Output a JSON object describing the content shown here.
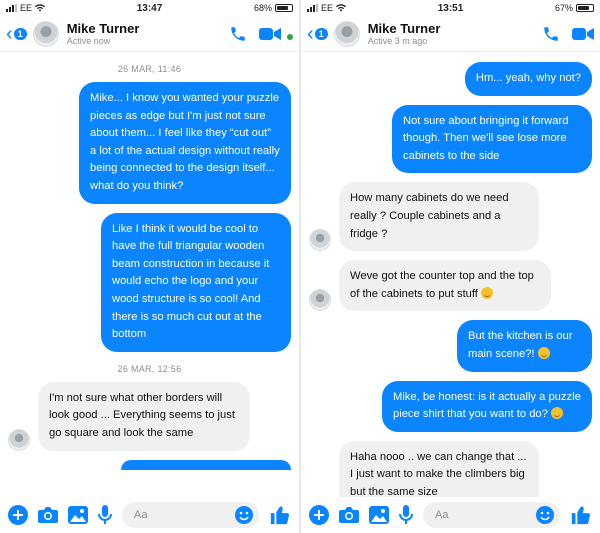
{
  "colors": {
    "accent": "#0a84ff",
    "incoming": "#f0f0f0",
    "online": "#31a24c"
  },
  "left": {
    "status": {
      "carrier": "EE",
      "time": "13:47",
      "battery": "68%"
    },
    "header": {
      "back_count": "1",
      "name": "Mike Turner",
      "sub": "Active now"
    },
    "messages": [
      {
        "type": "stamp",
        "text": "26 MAR, 11:46"
      },
      {
        "type": "out",
        "text": "Mike... I know you wanted your puzzle pieces as edge but I'm just not sure about them... I feel like they “cut out” a lot of the actual design without really being connected to the design itself... what do you think?"
      },
      {
        "type": "out",
        "text": "Like I think it would be cool to have the full triangular wooden beam construction in because it would echo the logo and your wood structure is so cool! And there is so much cut out at the bottom"
      },
      {
        "type": "stamp",
        "text": "26 MAR, 12:56"
      },
      {
        "type": "in",
        "text": "I'm not sure what other borders will look good ... Everything seems to just go square and look the same"
      }
    ],
    "composer": {
      "placeholder": "Aa"
    }
  },
  "right": {
    "status": {
      "carrier": "EE",
      "time": "13:51",
      "battery": "67%"
    },
    "header": {
      "back_count": "1",
      "name": "Mike Turner",
      "sub": "Active 3 m ago"
    },
    "messages": [
      {
        "type": "out",
        "text": "Hm... yeah, why not?"
      },
      {
        "type": "out",
        "text": "Not sure about bringing it forward though. Then we'll see lose more cabinets to the side"
      },
      {
        "type": "in",
        "text": "How many cabinets do we need really ? Couple cabinets and a fridge ?"
      },
      {
        "type": "in",
        "text": "Weve got the counter top and the top of the cabinets to put stuff",
        "emoji": true
      },
      {
        "type": "out",
        "text": "But the kitchen is our main scene?!",
        "emoji": true
      },
      {
        "type": "out",
        "text": "Mike, be honest: is it actually a puzzle piece shirt that you want to do?",
        "emoji": true
      },
      {
        "type": "in",
        "text": "Haha nooo .. we can change that ... I just want to make the climbers big but the same size"
      }
    ],
    "composer": {
      "placeholder": "Aa"
    }
  }
}
